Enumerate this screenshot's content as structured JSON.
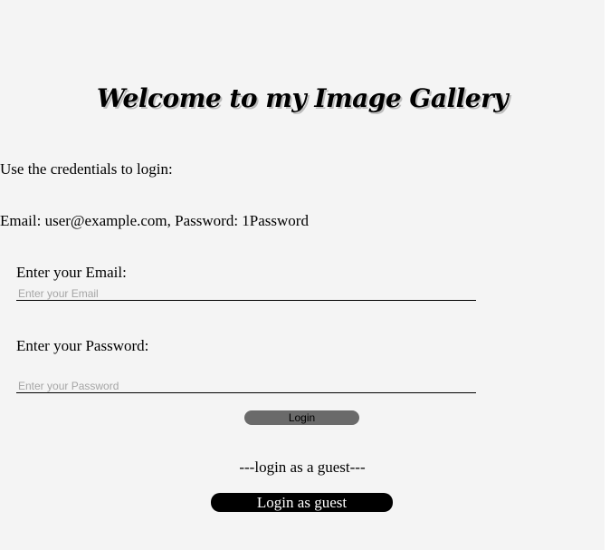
{
  "header": {
    "title": "Welcome to my Image Gallery"
  },
  "credentials": {
    "intro": "Use the credentials to login:",
    "details": "Email: user@example.com, Password: 1Password"
  },
  "form": {
    "email_label": "Enter your Email:",
    "email_placeholder": "Enter your Email",
    "email_value": "",
    "password_label": "Enter your Password:",
    "password_placeholder": "Enter your Password",
    "password_value": "",
    "login_label": "Login"
  },
  "guest": {
    "separator": "---login as a guest---",
    "button_label": "Login as guest"
  },
  "colors": {
    "background": "#f4f4f4",
    "login_button": "#6a6a6a",
    "guest_button": "#000000",
    "guest_button_text": "#ffffff"
  }
}
